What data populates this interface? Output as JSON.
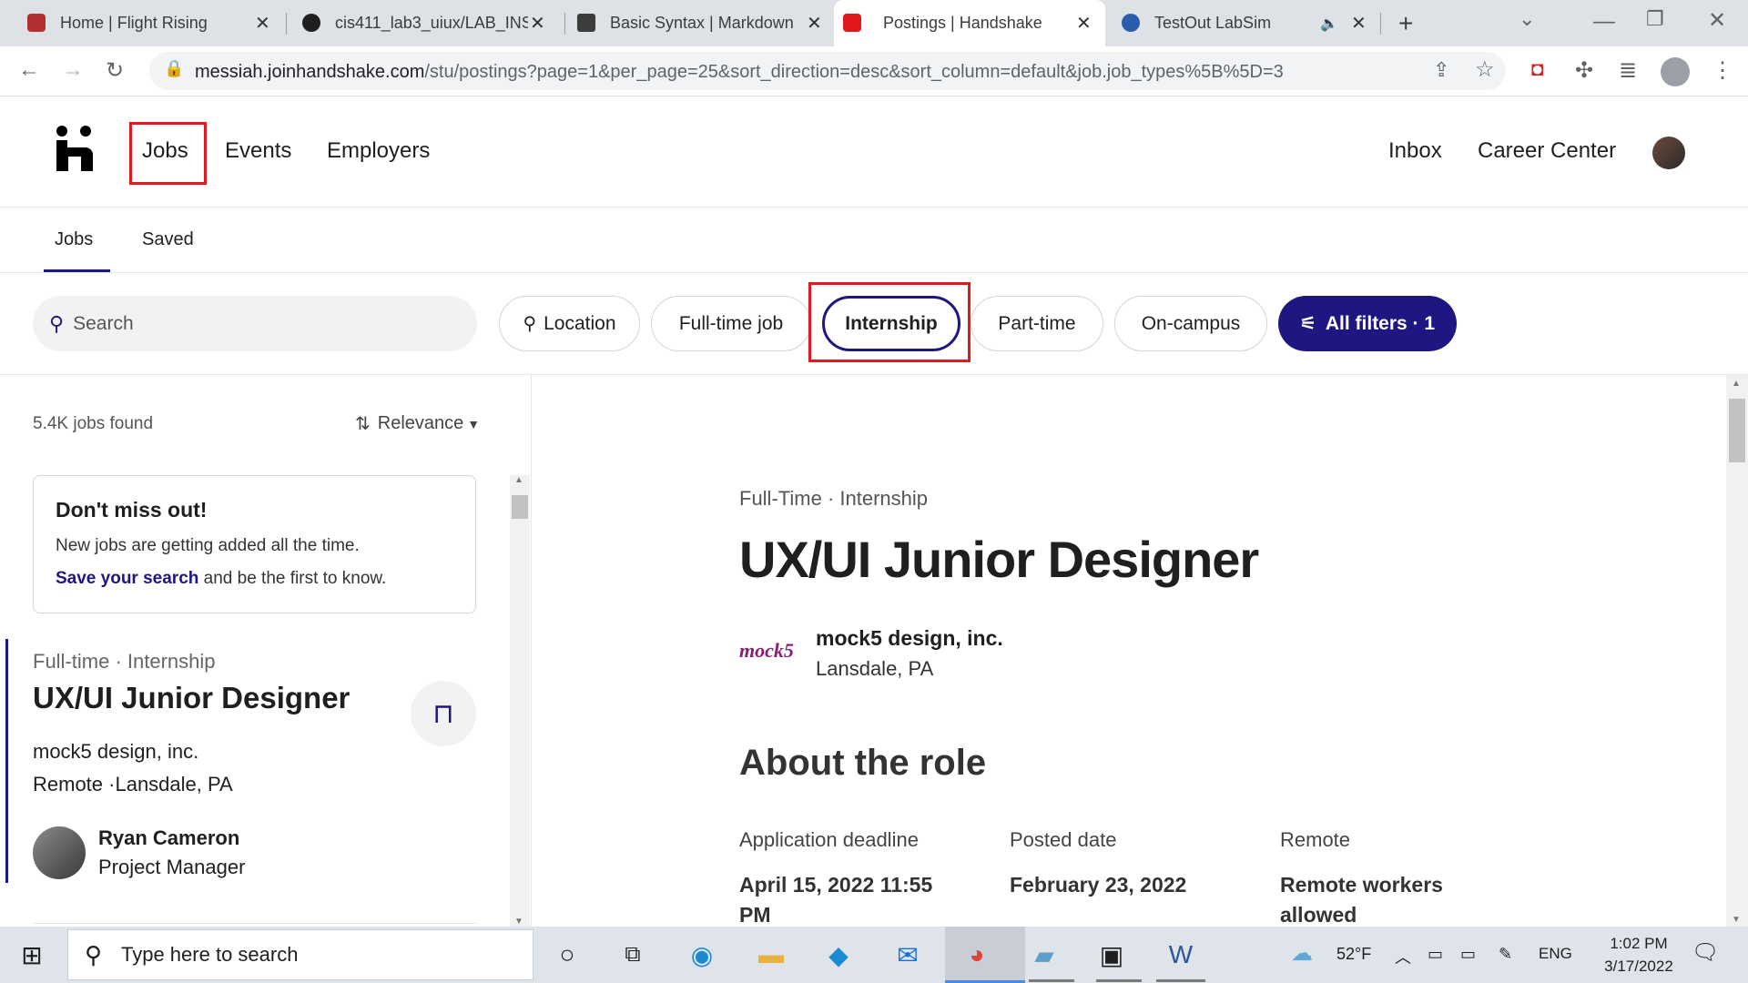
{
  "browser": {
    "tabs": [
      {
        "title": "Home | Flight Rising",
        "color": "#b32e2e"
      },
      {
        "title": "cis411_lab3_uiux/LAB_INS",
        "color": "#1f1f1f"
      },
      {
        "title": "Basic Syntax | Markdown G",
        "color": "#3c3c3c"
      },
      {
        "title": "Postings | Handshake",
        "color": "#e0191f"
      },
      {
        "title": "TestOut LabSim",
        "color": "#2b5dad"
      }
    ],
    "url_host": "messiah.joinhandshake.com",
    "url_path": "/stu/postings?page=1&per_page=25&sort_direction=desc&sort_column=default&job.job_types%5B%5D=3"
  },
  "header": {
    "nav": [
      "Jobs",
      "Events",
      "Employers"
    ],
    "right": [
      "Inbox",
      "Career Center"
    ]
  },
  "subnav": {
    "tabs": [
      "Jobs",
      "Saved"
    ]
  },
  "filters": {
    "search_placeholder": "Search",
    "pills": [
      "Location",
      "Full-time job",
      "Internship",
      "Part-time",
      "On-campus"
    ],
    "all_filters": "All filters · 1"
  },
  "list": {
    "count": "5.4K jobs found",
    "sort": "Relevance",
    "promo": {
      "title": "Don't miss out!",
      "line1": "New jobs are getting added all the time.",
      "link": "Save your search",
      "line2_rest": " and be the first to know."
    },
    "job": {
      "type": "Full-time · Internship",
      "title": "UX/UI Junior Designer",
      "company": "mock5 design, inc.",
      "location": "Remote ·Lansdale, PA",
      "contact_name": "Ryan Cameron",
      "contact_role": "Project Manager"
    }
  },
  "detail": {
    "type": "Full-Time · Internship",
    "title": "UX/UI Junior Designer",
    "logo_text": "mock5",
    "company": "mock5 design, inc.",
    "location": "Lansdale, PA",
    "section": "About the role",
    "facts": [
      {
        "label": "Application deadline",
        "value": "April 15, 2022 11:55 PM"
      },
      {
        "label": "Posted date",
        "value": "February 23, 2022"
      },
      {
        "label": "Remote",
        "value": "Remote workers allowed"
      }
    ]
  },
  "taskbar": {
    "search": "Type here to search",
    "weather": "52°F",
    "lang": "ENG",
    "time": "1:02 PM",
    "date": "3/17/2022"
  },
  "colors": {
    "brand": "#1f1781",
    "highlight": "#e0191f"
  }
}
